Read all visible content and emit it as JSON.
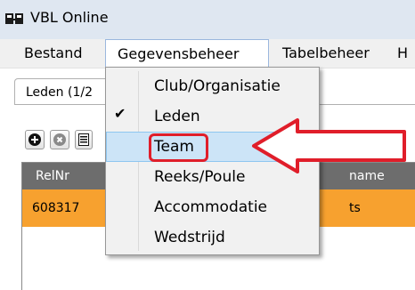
{
  "window": {
    "title": "VBL Online",
    "icon": "app-icon"
  },
  "menubar": {
    "items": [
      {
        "label": "Bestand"
      },
      {
        "label": "Gegevensbeheer"
      },
      {
        "label": "Tabelbeheer"
      },
      {
        "label": "H"
      }
    ]
  },
  "tab": {
    "label": "Leden (1/2"
  },
  "toolbar": {
    "buttons": [
      {
        "icon": "add-icon"
      },
      {
        "icon": "delete-icon"
      },
      {
        "icon": "document-icon"
      }
    ]
  },
  "grid": {
    "columns": [
      "RelNr",
      "name"
    ],
    "rows": [
      {
        "relnr": "608317",
        "name_cell": "ts"
      }
    ]
  },
  "dropdown": {
    "items": [
      {
        "label": "Club/Organisatie",
        "checked": false
      },
      {
        "label": "Leden",
        "checked": true
      },
      {
        "label": "Team",
        "checked": false,
        "highlighted": true
      },
      {
        "label": "Reeks/Poule",
        "checked": false
      },
      {
        "label": "Accommodatie",
        "checked": false
      },
      {
        "label": "Wedstrijd",
        "checked": false
      }
    ],
    "check_glyph": "✔"
  },
  "colors": {
    "accent_highlight": "#cce4f7",
    "annotation_red": "#e01e2a",
    "row_selected": "#f7a12f",
    "grid_header": "#6d6d6d"
  }
}
